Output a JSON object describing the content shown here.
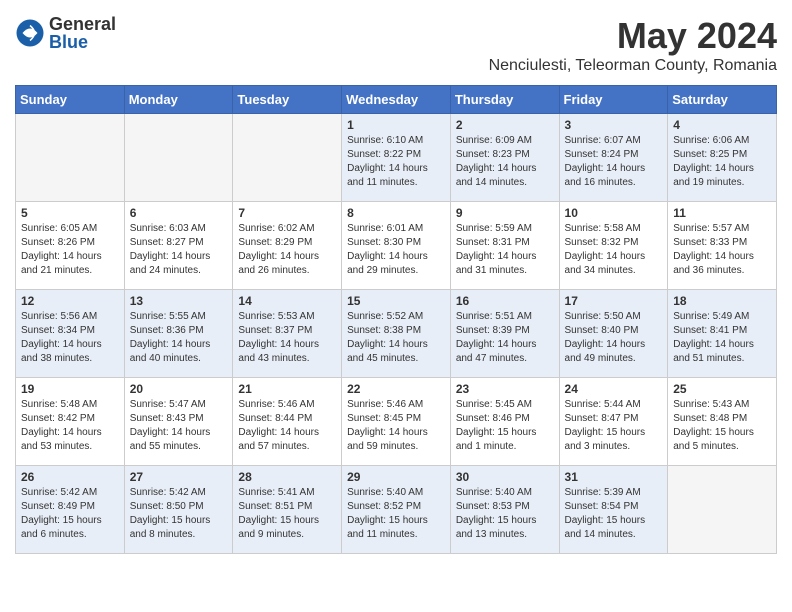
{
  "logo": {
    "general": "General",
    "blue": "Blue"
  },
  "header": {
    "month": "May 2024",
    "location": "Nenciulesti, Teleorman County, Romania"
  },
  "weekdays": [
    "Sunday",
    "Monday",
    "Tuesday",
    "Wednesday",
    "Thursday",
    "Friday",
    "Saturday"
  ],
  "weeks": [
    [
      {
        "day": "",
        "info": ""
      },
      {
        "day": "",
        "info": ""
      },
      {
        "day": "",
        "info": ""
      },
      {
        "day": "1",
        "info": "Sunrise: 6:10 AM\nSunset: 8:22 PM\nDaylight: 14 hours\nand 11 minutes."
      },
      {
        "day": "2",
        "info": "Sunrise: 6:09 AM\nSunset: 8:23 PM\nDaylight: 14 hours\nand 14 minutes."
      },
      {
        "day": "3",
        "info": "Sunrise: 6:07 AM\nSunset: 8:24 PM\nDaylight: 14 hours\nand 16 minutes."
      },
      {
        "day": "4",
        "info": "Sunrise: 6:06 AM\nSunset: 8:25 PM\nDaylight: 14 hours\nand 19 minutes."
      }
    ],
    [
      {
        "day": "5",
        "info": "Sunrise: 6:05 AM\nSunset: 8:26 PM\nDaylight: 14 hours\nand 21 minutes."
      },
      {
        "day": "6",
        "info": "Sunrise: 6:03 AM\nSunset: 8:27 PM\nDaylight: 14 hours\nand 24 minutes."
      },
      {
        "day": "7",
        "info": "Sunrise: 6:02 AM\nSunset: 8:29 PM\nDaylight: 14 hours\nand 26 minutes."
      },
      {
        "day": "8",
        "info": "Sunrise: 6:01 AM\nSunset: 8:30 PM\nDaylight: 14 hours\nand 29 minutes."
      },
      {
        "day": "9",
        "info": "Sunrise: 5:59 AM\nSunset: 8:31 PM\nDaylight: 14 hours\nand 31 minutes."
      },
      {
        "day": "10",
        "info": "Sunrise: 5:58 AM\nSunset: 8:32 PM\nDaylight: 14 hours\nand 34 minutes."
      },
      {
        "day": "11",
        "info": "Sunrise: 5:57 AM\nSunset: 8:33 PM\nDaylight: 14 hours\nand 36 minutes."
      }
    ],
    [
      {
        "day": "12",
        "info": "Sunrise: 5:56 AM\nSunset: 8:34 PM\nDaylight: 14 hours\nand 38 minutes."
      },
      {
        "day": "13",
        "info": "Sunrise: 5:55 AM\nSunset: 8:36 PM\nDaylight: 14 hours\nand 40 minutes."
      },
      {
        "day": "14",
        "info": "Sunrise: 5:53 AM\nSunset: 8:37 PM\nDaylight: 14 hours\nand 43 minutes."
      },
      {
        "day": "15",
        "info": "Sunrise: 5:52 AM\nSunset: 8:38 PM\nDaylight: 14 hours\nand 45 minutes."
      },
      {
        "day": "16",
        "info": "Sunrise: 5:51 AM\nSunset: 8:39 PM\nDaylight: 14 hours\nand 47 minutes."
      },
      {
        "day": "17",
        "info": "Sunrise: 5:50 AM\nSunset: 8:40 PM\nDaylight: 14 hours\nand 49 minutes."
      },
      {
        "day": "18",
        "info": "Sunrise: 5:49 AM\nSunset: 8:41 PM\nDaylight: 14 hours\nand 51 minutes."
      }
    ],
    [
      {
        "day": "19",
        "info": "Sunrise: 5:48 AM\nSunset: 8:42 PM\nDaylight: 14 hours\nand 53 minutes."
      },
      {
        "day": "20",
        "info": "Sunrise: 5:47 AM\nSunset: 8:43 PM\nDaylight: 14 hours\nand 55 minutes."
      },
      {
        "day": "21",
        "info": "Sunrise: 5:46 AM\nSunset: 8:44 PM\nDaylight: 14 hours\nand 57 minutes."
      },
      {
        "day": "22",
        "info": "Sunrise: 5:46 AM\nSunset: 8:45 PM\nDaylight: 14 hours\nand 59 minutes."
      },
      {
        "day": "23",
        "info": "Sunrise: 5:45 AM\nSunset: 8:46 PM\nDaylight: 15 hours\nand 1 minute."
      },
      {
        "day": "24",
        "info": "Sunrise: 5:44 AM\nSunset: 8:47 PM\nDaylight: 15 hours\nand 3 minutes."
      },
      {
        "day": "25",
        "info": "Sunrise: 5:43 AM\nSunset: 8:48 PM\nDaylight: 15 hours\nand 5 minutes."
      }
    ],
    [
      {
        "day": "26",
        "info": "Sunrise: 5:42 AM\nSunset: 8:49 PM\nDaylight: 15 hours\nand 6 minutes."
      },
      {
        "day": "27",
        "info": "Sunrise: 5:42 AM\nSunset: 8:50 PM\nDaylight: 15 hours\nand 8 minutes."
      },
      {
        "day": "28",
        "info": "Sunrise: 5:41 AM\nSunset: 8:51 PM\nDaylight: 15 hours\nand 9 minutes."
      },
      {
        "day": "29",
        "info": "Sunrise: 5:40 AM\nSunset: 8:52 PM\nDaylight: 15 hours\nand 11 minutes."
      },
      {
        "day": "30",
        "info": "Sunrise: 5:40 AM\nSunset: 8:53 PM\nDaylight: 15 hours\nand 13 minutes."
      },
      {
        "day": "31",
        "info": "Sunrise: 5:39 AM\nSunset: 8:54 PM\nDaylight: 15 hours\nand 14 minutes."
      },
      {
        "day": "",
        "info": ""
      }
    ]
  ]
}
